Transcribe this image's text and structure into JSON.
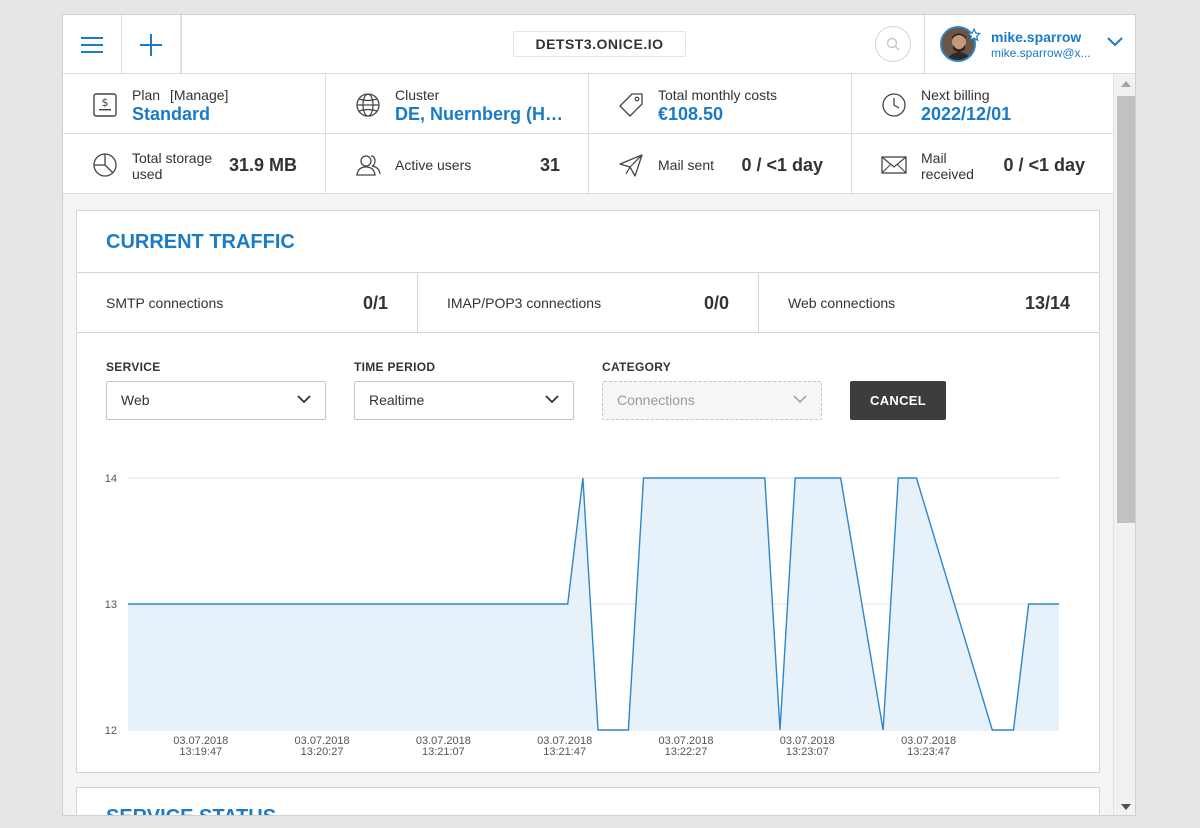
{
  "header": {
    "domain": "DETST3.ONICE.IO",
    "user": {
      "name": "mike.sparrow",
      "email": "mike.sparrow@x..."
    }
  },
  "info": {
    "plan": {
      "label": "Plan",
      "manage": "[Manage]",
      "value": "Standard"
    },
    "cluster": {
      "label": "Cluster",
      "value": "DE, Nuernberg (He..."
    },
    "costs": {
      "label": "Total monthly costs",
      "value": "€108.50"
    },
    "billing": {
      "label": "Next billing",
      "value": "2022/12/01"
    },
    "storage": {
      "label_line1": "Total storage",
      "label_line2": "used",
      "value": "31.9 MB"
    },
    "users": {
      "label": "Active users",
      "value": "31"
    },
    "mail_sent": {
      "label": "Mail sent",
      "value": "0 / <1 day"
    },
    "mail_received": {
      "label_line1": "Mail",
      "label_line2": "received",
      "value": "0 / <1 day"
    }
  },
  "traffic": {
    "title": "CURRENT TRAFFIC",
    "connections": [
      {
        "label": "SMTP connections",
        "value": "0/1"
      },
      {
        "label": "IMAP/POP3 connections",
        "value": "0/0"
      },
      {
        "label": "Web connections",
        "value": "13/14"
      }
    ],
    "filters": {
      "service": {
        "label": "SERVICE",
        "value": "Web"
      },
      "period": {
        "label": "TIME PERIOD",
        "value": "Realtime"
      },
      "category": {
        "label": "CATEGORY",
        "value": "Connections"
      }
    },
    "cancel_label": "CANCEL"
  },
  "service_status": {
    "title": "SERVICE STATUS"
  },
  "colors": {
    "accent": "#1a7cc6",
    "chart_line": "#2f86c8",
    "chart_fill": "#e6f1fa",
    "button_dark": "#3d3d3d"
  },
  "chart_data": {
    "type": "area",
    "ylim": [
      12,
      14
    ],
    "yticks": [
      12,
      13,
      14
    ],
    "xticks": [
      {
        "t": 0,
        "date": "03.07.2018",
        "time": "13:19:47"
      },
      {
        "t": 40,
        "date": "03.07.2018",
        "time": "13:20:27"
      },
      {
        "t": 80,
        "date": "03.07.2018",
        "time": "13:21:07"
      },
      {
        "t": 120,
        "date": "03.07.2018",
        "time": "13:21:47"
      },
      {
        "t": 160,
        "date": "03.07.2018",
        "time": "13:22:27"
      },
      {
        "t": 200,
        "date": "03.07.2018",
        "time": "13:23:07"
      },
      {
        "t": 240,
        "date": "03.07.2018",
        "time": "13:23:47"
      }
    ],
    "series": [
      {
        "x": [
          -24,
          121,
          126,
          131,
          141,
          146,
          186,
          191,
          196,
          211,
          225,
          230,
          236,
          261,
          268,
          273,
          277,
          283
        ],
        "y": [
          13,
          13,
          14,
          12,
          12,
          14,
          14,
          12,
          14,
          14,
          12,
          14,
          14,
          12,
          12,
          13,
          13,
          13
        ]
      }
    ]
  }
}
